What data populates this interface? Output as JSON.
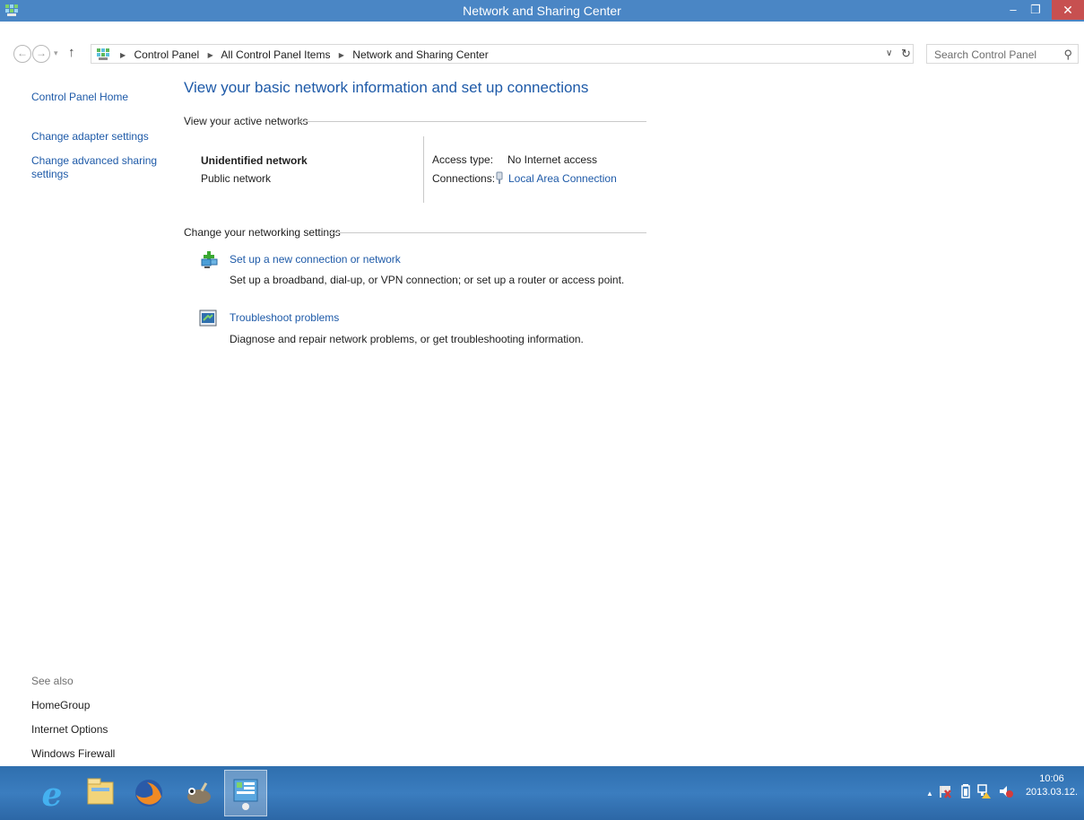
{
  "window": {
    "title": "Network and Sharing Center",
    "minimize_glyph": "–",
    "maximize_glyph": "❐",
    "close_glyph": "✕"
  },
  "navigation": {
    "back_glyph": "←",
    "forward_glyph": "→",
    "recent_glyph": "▾",
    "up_glyph": "↑",
    "breadcrumbs": [
      "Control Panel",
      "All Control Panel Items",
      "Network and Sharing Center"
    ],
    "separator": "▶",
    "dropdown_glyph": "∨",
    "refresh_glyph": "↻",
    "search_placeholder": "Search Control Panel",
    "search_glyph": "⚲"
  },
  "left_pane": {
    "home": "Control Panel Home",
    "links": [
      "Change adapter settings",
      "Change advanced sharing",
      "settings"
    ],
    "see_also_label": "See also",
    "see_also": [
      "HomeGroup",
      "Internet Options",
      "Windows Firewall"
    ]
  },
  "main": {
    "heading": "View your basic network information and set up connections",
    "active_networks_label": "View your active networks",
    "network_name": "Unidentified network",
    "network_type": "Public network",
    "access_type_label": "Access type:",
    "access_type_value": "No Internet access",
    "connections_label": "Connections:",
    "connections_value": "Local Area Connection",
    "change_settings_label": "Change your networking settings",
    "tasks": [
      {
        "title": "Set up a new connection or network",
        "desc": "Set up a broadband, dial-up, or VPN connection; or set up a router or access point.",
        "icon": "new-connection-icon"
      },
      {
        "title": "Troubleshoot problems",
        "desc": "Diagnose and repair network problems, or get troubleshooting information.",
        "icon": "troubleshoot-icon"
      }
    ]
  },
  "taskbar": {
    "items": [
      "internet-explorer-icon",
      "file-explorer-icon",
      "firefox-icon",
      "gimp-icon",
      "control-panel-icon"
    ],
    "tray_chevron": "▲",
    "time": "10:06",
    "date": "2013.03.12."
  },
  "colors": {
    "titlebar": "#4a86c5",
    "link": "#1e5aa8",
    "close": "#c75050",
    "taskbar": "#3b7dbf"
  }
}
